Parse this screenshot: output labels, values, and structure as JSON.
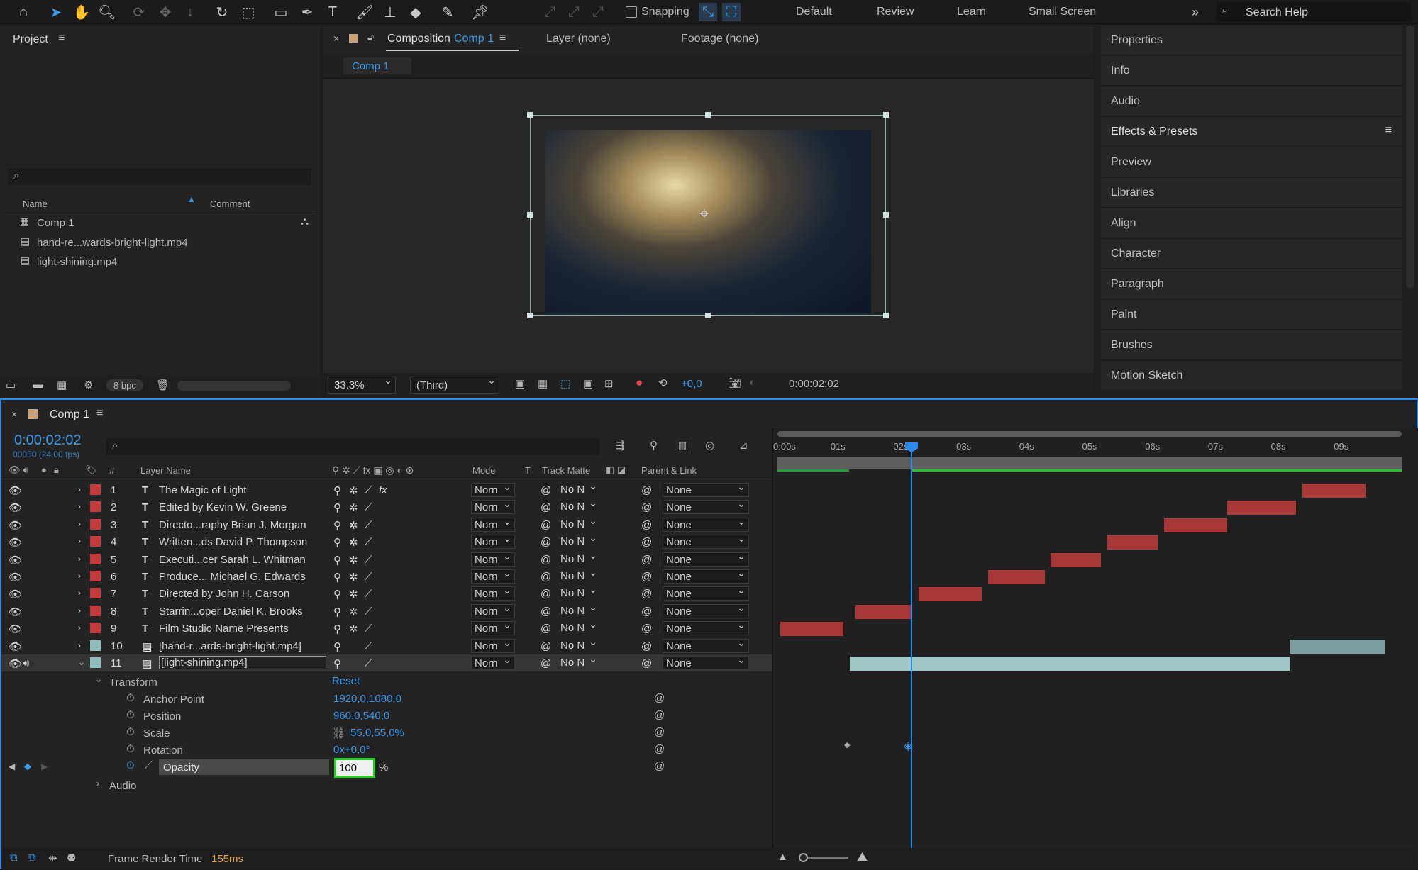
{
  "toolbar": {
    "snapping": "Snapping",
    "workspaces": [
      "Default",
      "Review",
      "Learn",
      "Small Screen"
    ],
    "search_placeholder": "Search Help"
  },
  "project": {
    "title": "Project",
    "col_name": "Name",
    "col_comment": "Comment",
    "items": [
      "Comp 1",
      "hand-re...wards-bright-light.mp4",
      "light-shining.mp4"
    ],
    "bpc": "8 bpc"
  },
  "comp_viewer": {
    "tab_prefix": "Composition",
    "tab_comp": "Comp 1",
    "layer_tab": "Layer (none)",
    "footage_tab": "Footage (none)",
    "sub_tab": "Comp 1",
    "zoom": "33.3%",
    "resolution": "(Third)",
    "exposure": "+0,0",
    "timecode": "0:00:02:02"
  },
  "right_panel": {
    "items": [
      "Properties",
      "Info",
      "Audio",
      "Effects & Presets",
      "Preview",
      "Libraries",
      "Align",
      "Character",
      "Paragraph",
      "Paint",
      "Brushes",
      "Motion Sketch"
    ]
  },
  "timeline": {
    "title": "Comp 1",
    "timecode": "0:00:02:02",
    "frames": "00050 (24.00 fps)",
    "cols": {
      "num": "#",
      "name": "Layer Name",
      "mode": "Mode",
      "t": "T",
      "track": "Track Matte",
      "parent": "Parent & Link"
    },
    "ruler": [
      "0:00s",
      "01s",
      "02s",
      "03s",
      "04s",
      "05s",
      "06s",
      "07s",
      "08s",
      "09s"
    ],
    "layers": [
      {
        "n": "1",
        "name": "The Magic of Light",
        "mode": "Norn",
        "track": "No N",
        "parent": "None"
      },
      {
        "n": "2",
        "name": "Edited by  Kevin W. Greene",
        "mode": "Norn",
        "track": "No N",
        "parent": "None"
      },
      {
        "n": "3",
        "name": "Directo...raphy  Brian J. Morgan",
        "mode": "Norn",
        "track": "No N",
        "parent": "None"
      },
      {
        "n": "4",
        "name": "Written...ds David P. Thompson",
        "mode": "Norn",
        "track": "No N",
        "parent": "None"
      },
      {
        "n": "5",
        "name": "Executi...cer  Sarah L. Whitman",
        "mode": "Norn",
        "track": "No N",
        "parent": "None"
      },
      {
        "n": "6",
        "name": "Produce...  Michael G. Edwards",
        "mode": "Norn",
        "track": "No N",
        "parent": "None"
      },
      {
        "n": "7",
        "name": "Directed by  John H. Carson",
        "mode": "Norn",
        "track": "No N",
        "parent": "None"
      },
      {
        "n": "8",
        "name": "Starrin...oper Daniel K. Brooks",
        "mode": "Norn",
        "track": "No N",
        "parent": "None"
      },
      {
        "n": "9",
        "name": "Film Studio Name Presents",
        "mode": "Norn",
        "track": "No N",
        "parent": "None"
      },
      {
        "n": "10",
        "name": "[hand-r...ards-bright-light.mp4]",
        "mode": "Norn",
        "track": "No N",
        "parent": "None"
      },
      {
        "n": "11",
        "name": "[light-shining.mp4]",
        "mode": "Norn",
        "track": "No N",
        "parent": "None"
      }
    ],
    "transform": {
      "label": "Transform",
      "reset": "Reset",
      "anchor_label": "Anchor Point",
      "anchor": "1920,0,1080,0",
      "position_label": "Position",
      "position": "960,0,540,0",
      "scale_label": "Scale",
      "scale": "55,0,55,0%",
      "rotation_label": "Rotation",
      "rotation": "0x+0,0°",
      "opacity_label": "Opacity",
      "opacity": "100",
      "opacity_unit": "%",
      "audio_label": "Audio"
    },
    "status": {
      "label": "Frame Render Time",
      "value": "155ms"
    }
  },
  "colors": {
    "accent": "#2d8ceb",
    "layer_red": "#c23a3a",
    "layer_teal": "#8fbdbd"
  }
}
